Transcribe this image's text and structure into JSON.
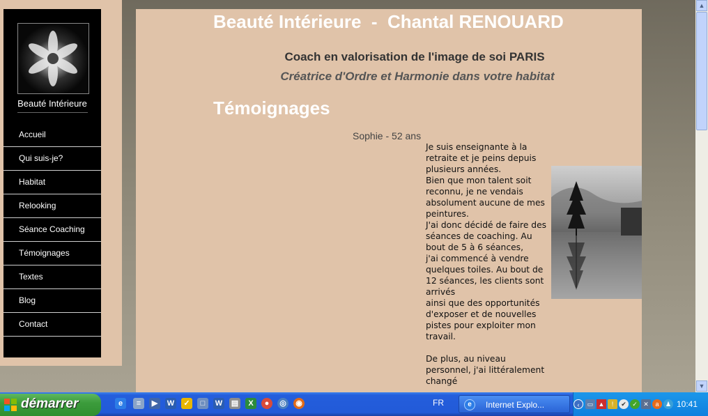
{
  "sidebar": {
    "logo_text": "Beauté Intérieure",
    "nav_items": [
      {
        "label": "Accueil"
      },
      {
        "label": "Qui suis-je?"
      },
      {
        "label": "Habitat"
      },
      {
        "label": "Relooking"
      },
      {
        "label": "Séance Coaching"
      },
      {
        "label": "Témoignages"
      },
      {
        "label": "Textes"
      },
      {
        "label": "Blog"
      },
      {
        "label": "Contact"
      }
    ]
  },
  "header": {
    "title": "Beauté Intérieure  -  Chantal RENOUARD",
    "subtitle_1": "Coach en valorisation de l'image de soi PARIS",
    "subtitle_2": "Créatrice d'Ordre et Harmonie dans votre habitat"
  },
  "main": {
    "page_title": "Témoignages",
    "author": "Sophie - 52 ans",
    "testimonial_text": "Je suis enseignante à la retraite et je peins depuis plusieurs années.\nBien que mon talent soit reconnu, je ne vendais absolument aucune de mes peintures.\nJ'ai donc décidé de faire des séances de coaching. Au bout de 5 à 6 séances,\nj'ai commencé à vendre quelques toiles. Au bout de 12 séances, les clients sont arrivés\nainsi que des opportunités d'exposer et de nouvelles pistes pour exploiter mon travail.\n\nDe plus, au niveau personnel, j'ai littéralement changé"
  },
  "taskbar": {
    "start_label": "démarrer",
    "language": "FR",
    "task_label": "Internet Explo...",
    "clock": "10:41",
    "quicklaunch_icons": [
      "ie-icon",
      "document-icon",
      "media-player-icon",
      "word-icon",
      "norton-icon",
      "window-icon",
      "word-doc-icon",
      "printer-icon",
      "excel-icon",
      "chrome-icon",
      "network-icon",
      "firefox-icon"
    ],
    "tray_icons": [
      "back-arrow-icon",
      "network-icon",
      "volume-icon",
      "antivirus-icon",
      "shield-icon",
      "checkmark-icon",
      "disconnected-icon",
      "avast-icon",
      "user-icon"
    ]
  },
  "colors": {
    "content_bg": "#e0c3a9",
    "sidebar_bg": "#000000",
    "taskbar_blue": "#245edc",
    "start_green": "#3c9c3c"
  }
}
